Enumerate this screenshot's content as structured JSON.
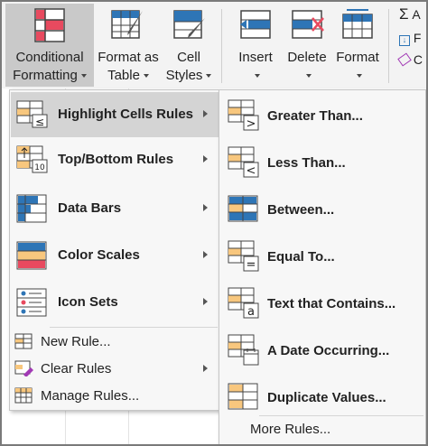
{
  "ribbon": {
    "conditional_formatting": {
      "line1": "Conditional",
      "line2": "Formatting",
      "icon": "conditional-formatting-icon"
    },
    "format_as_table": {
      "line1": "Format as",
      "line2": "Table",
      "icon": "format-as-table-icon"
    },
    "cell_styles": {
      "line1": "Cell",
      "line2": "Styles",
      "icon": "cell-styles-icon"
    },
    "insert": {
      "label": "Insert",
      "icon": "insert-cells-icon"
    },
    "delete": {
      "label": "Delete",
      "icon": "delete-cells-icon"
    },
    "format": {
      "label": "Format",
      "icon": "format-cells-icon"
    },
    "editing_truncated": [
      "A",
      "F",
      "C"
    ]
  },
  "menu": {
    "items": [
      {
        "label": "Highlight Cells Rules",
        "icon": "highlight-cells-rules-icon"
      },
      {
        "label": "Top/Bottom Rules",
        "icon": "top-bottom-rules-icon"
      },
      {
        "label": "Data Bars",
        "icon": "data-bars-icon"
      },
      {
        "label": "Color Scales",
        "icon": "color-scales-icon"
      },
      {
        "label": "Icon Sets",
        "icon": "icon-sets-icon"
      }
    ],
    "small_items": [
      {
        "label": "New Rule...",
        "icon": "new-rule-icon"
      },
      {
        "label": "Clear Rules",
        "icon": "clear-rules-icon"
      },
      {
        "label": "Manage Rules...",
        "icon": "manage-rules-icon"
      }
    ]
  },
  "submenu": {
    "items": [
      {
        "label": "Greater Than...",
        "icon": "greater-than-icon"
      },
      {
        "label": "Less Than...",
        "icon": "less-than-icon"
      },
      {
        "label": "Between...",
        "icon": "between-icon"
      },
      {
        "label": "Equal To...",
        "icon": "equal-to-icon"
      },
      {
        "label": "Text that Contains...",
        "icon": "text-contains-icon"
      },
      {
        "label": "A Date Occurring...",
        "icon": "date-occurring-icon"
      },
      {
        "label": "Duplicate Values...",
        "icon": "duplicate-values-icon"
      }
    ],
    "more_rules": "More Rules..."
  },
  "colors": {
    "accent_blue": "#2e75b6",
    "highlight_red": "#e84a5f",
    "cell_orange": "#f8c77e",
    "menu_highlight": "#d4d4d4"
  }
}
